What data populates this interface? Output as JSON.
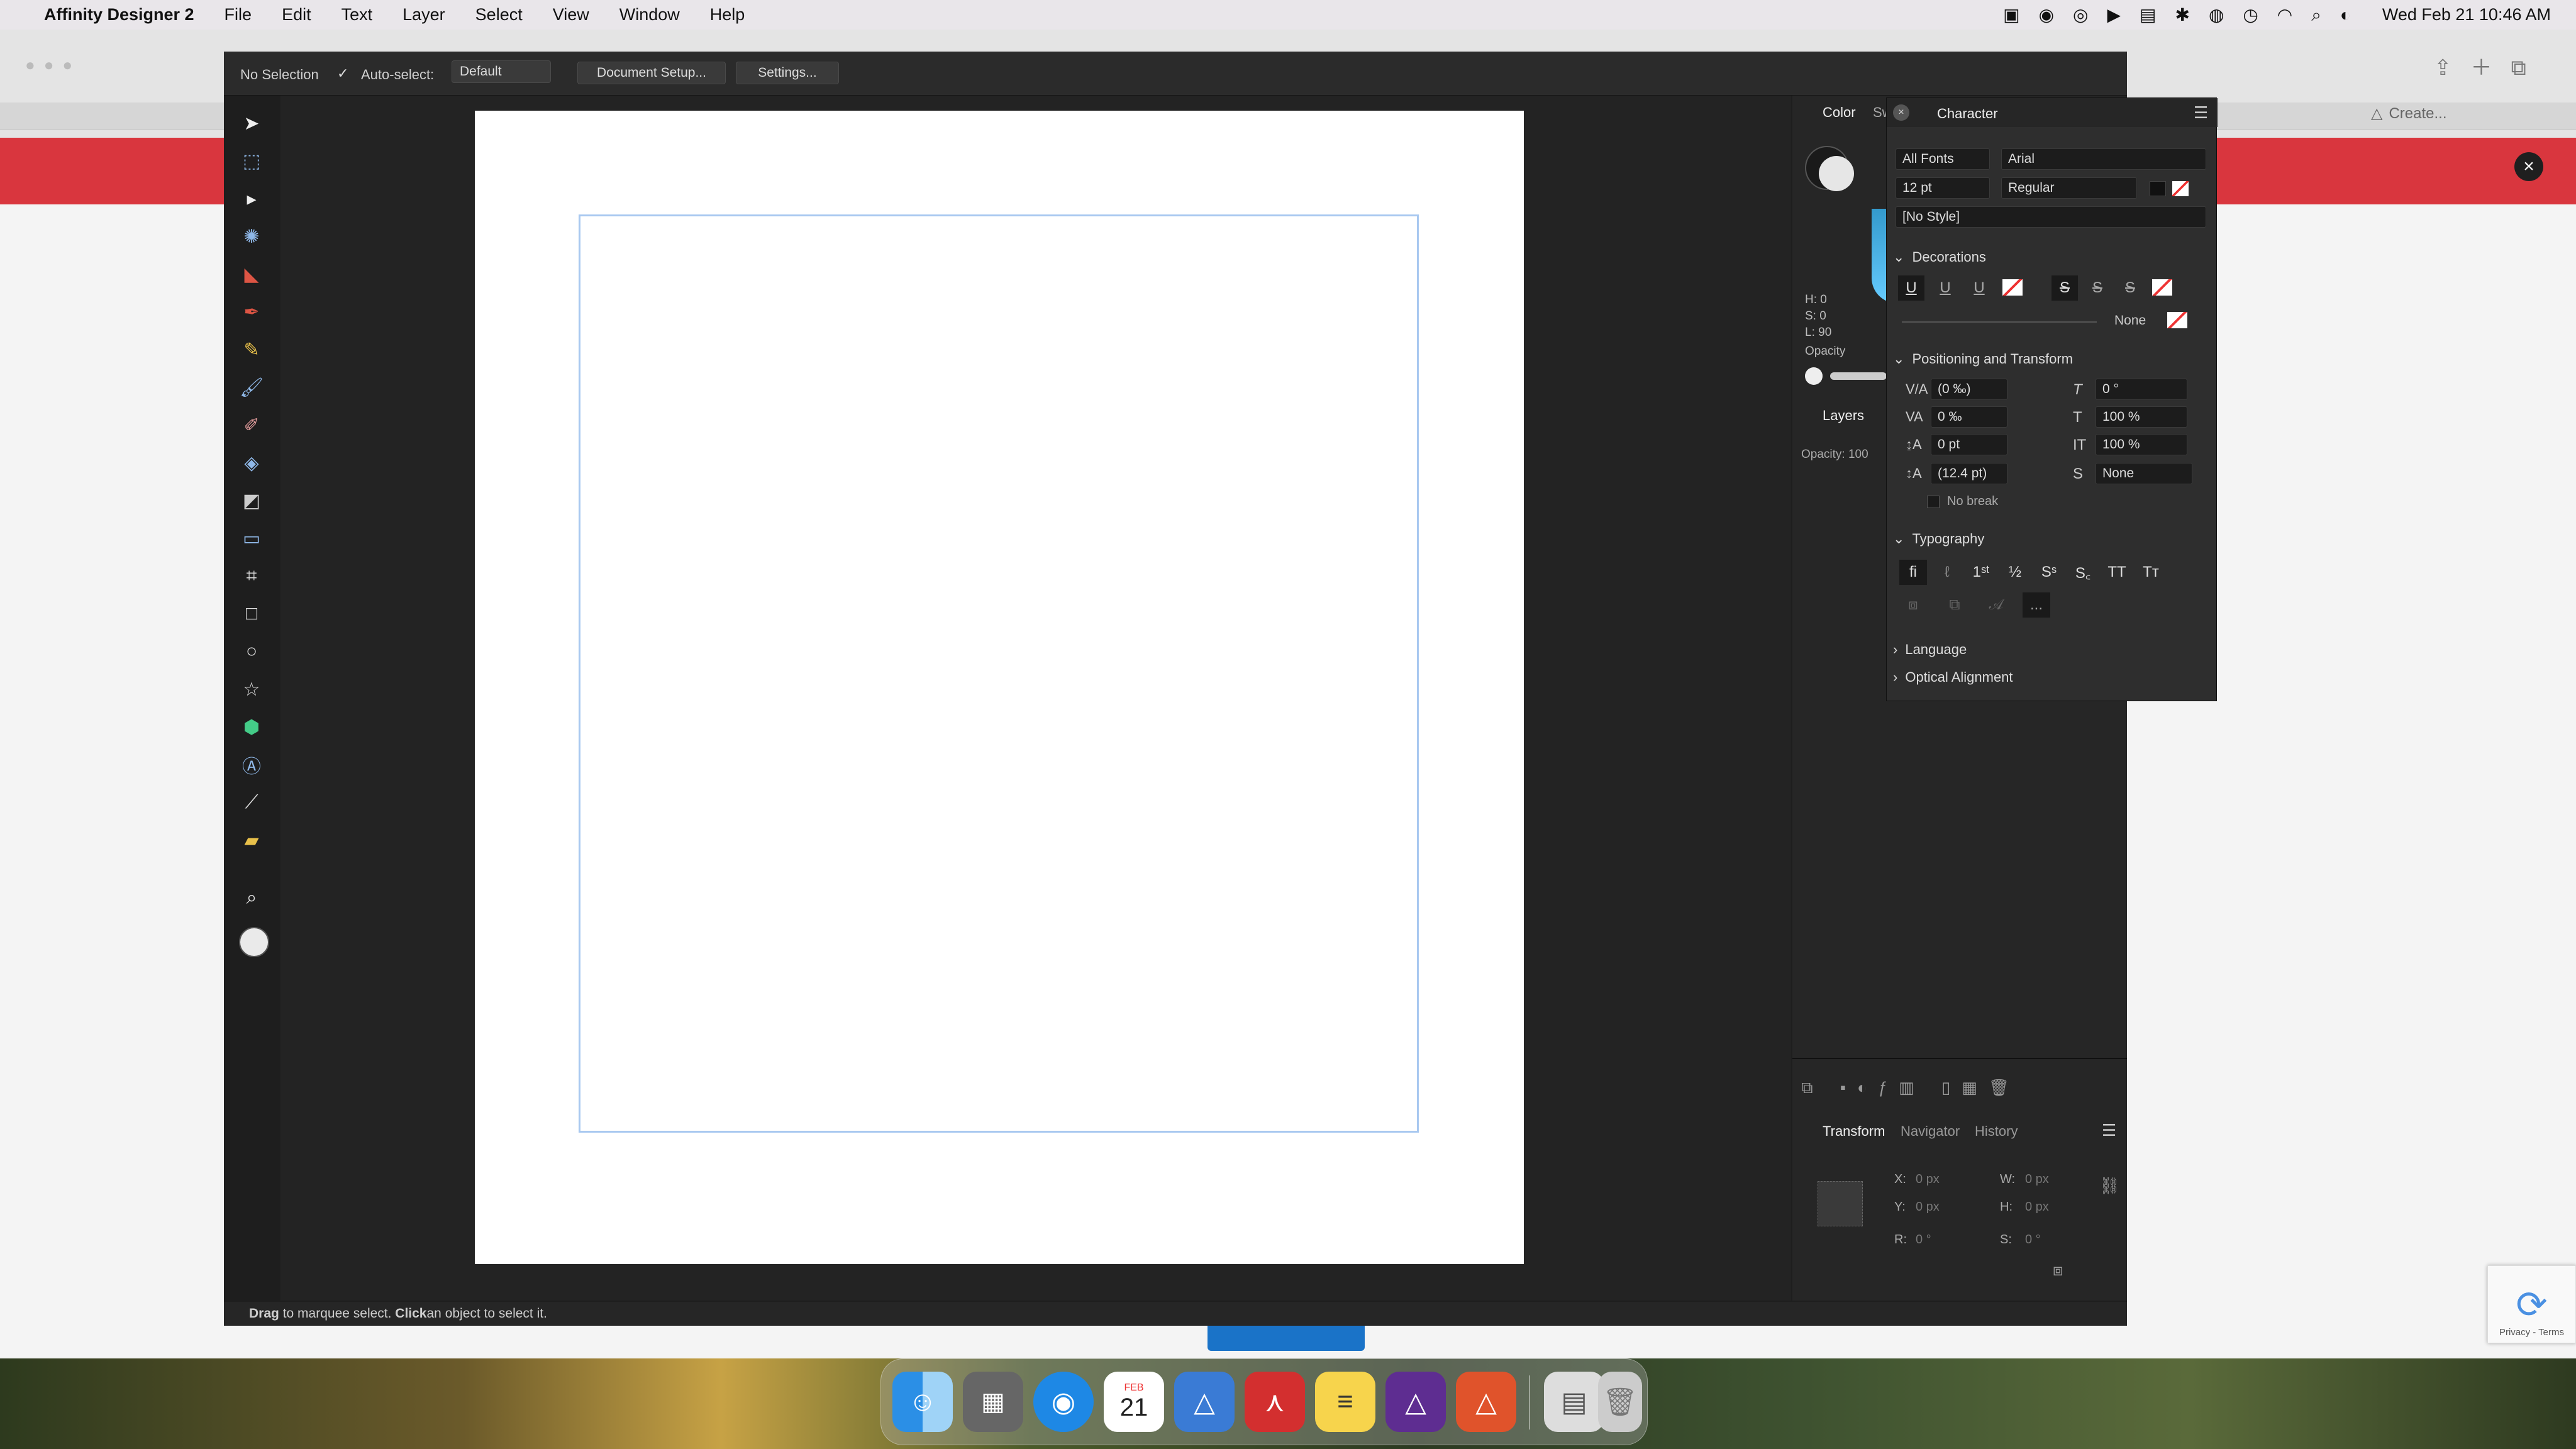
{
  "menubar": {
    "app_name": "Affinity Designer 2",
    "menus": [
      "File",
      "Edit",
      "Text",
      "Layer",
      "Select",
      "View",
      "Window",
      "Help"
    ],
    "clock": "Wed Feb 21  10:46 AM"
  },
  "browser": {
    "tab_create": "Create..."
  },
  "context_toolbar": {
    "selection": "No Selection",
    "auto_select_label": "Auto-select:",
    "auto_select_value": "Default",
    "document_setup": "Document Setup...",
    "settings": "Settings..."
  },
  "panels": {
    "color_tab": "Color",
    "sw_tab": "Sw",
    "hsl": {
      "h": "H: 0",
      "s": "S: 0",
      "l": "L: 90"
    },
    "opacity_label": "Opacity",
    "layers_tab": "Layers",
    "layers_opacity": "Opacity: 100"
  },
  "character": {
    "title": "Character",
    "font_collection": "All Fonts",
    "font_family": "Arial",
    "font_size": "12 pt",
    "font_style": "Regular",
    "text_style": "[No Style]",
    "decorations_label": "Decorations",
    "decorations_none": "None",
    "positioning_label": "Positioning and Transform",
    "kerning": "(0 ‰)",
    "tracking": "0 ‰",
    "baseline": "0 pt",
    "leading": "(12.4 pt)",
    "shear": "0 °",
    "vscale": "100 %",
    "hscale": "100 %",
    "superscript_style": "None",
    "no_break": "No break",
    "typography_label": "Typography",
    "typo_glyphs": [
      "fi",
      "ℓ",
      "1ˢᵗ",
      "½",
      "Sˢ",
      "S꜀",
      "TT",
      "Tт"
    ],
    "more": "...",
    "language_label": "Language",
    "optical_label": "Optical Alignment"
  },
  "transform": {
    "tabs": [
      "Transform",
      "Navigator",
      "History"
    ],
    "x_label": "X:",
    "x": "0 px",
    "y_label": "Y:",
    "y": "0 px",
    "w_label": "W:",
    "w": "0 px",
    "h_label": "H:",
    "h": "0 px",
    "r_label": "R:",
    "r": "0 °",
    "s_label": "S:",
    "s": "0 °"
  },
  "status": {
    "drag": "Drag",
    "drag_text": " to marquee select. ",
    "click": "Click",
    "click_text": " an object to select it."
  },
  "dock": {
    "calendar_month": "FEB",
    "calendar_day": "21"
  },
  "captcha": {
    "terms": "Privacy - Terms"
  },
  "colors": {
    "accent": "#1a73c8",
    "selection_frame": "#a8c8f0",
    "alert_bar": "#d9363e"
  }
}
